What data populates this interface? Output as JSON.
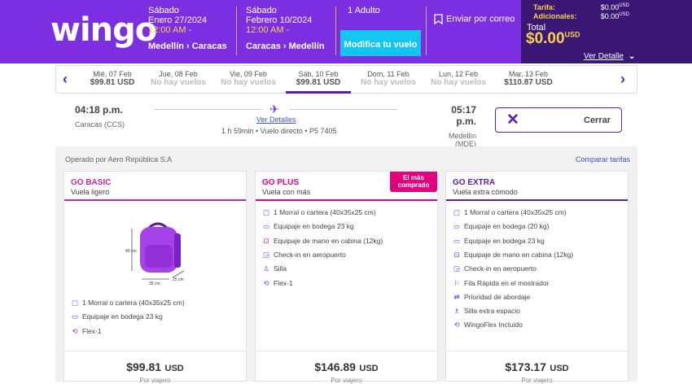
{
  "header": {
    "logo": "wingo",
    "outbound": {
      "day": "Sábado",
      "date": "Enero 27/2024",
      "time": "12:00 AM -",
      "route": "Medellín › Caracas"
    },
    "inbound": {
      "day": "Sábado",
      "date": "Febrero 10/2024",
      "time": "12:00 AM -",
      "route": "Caracas › Medellín"
    },
    "passengers": "1 Adulto",
    "modify_label": "Modifica tu vuelo",
    "email_label": "Enviar por correo"
  },
  "price_summary": {
    "tarifa_label": "Tarifa:",
    "tarifa_value": "$0.00",
    "adicionales_label": "Adicionales:",
    "adicionales_value": "$0.00",
    "currency_small": "USD",
    "total_label": "Total",
    "total_value": "$0.00",
    "total_currency": "USD",
    "details_label": "Ver Detalle"
  },
  "dates": [
    {
      "date": "Mié, 07 Feb",
      "price": "$99.81 USD",
      "available": true,
      "selected": false
    },
    {
      "date": "Jue, 08 Feb",
      "price": "No hay vuelos",
      "available": false,
      "selected": false
    },
    {
      "date": "Vie, 09 Feb",
      "price": "No hay vuelos",
      "available": false,
      "selected": false
    },
    {
      "date": "Sáb, 10 Feb",
      "price": "$99.81 USD",
      "available": true,
      "selected": true
    },
    {
      "date": "Dom, 11 Feb",
      "price": "No hay vuelos",
      "available": false,
      "selected": false
    },
    {
      "date": "Lun, 12 Feb",
      "price": "No hay vuelos",
      "available": false,
      "selected": false
    },
    {
      "date": "Mar, 13 Feb",
      "price": "$110.87 USD",
      "available": true,
      "selected": false
    }
  ],
  "flight": {
    "departure_time": "04:18 p.m.",
    "departure_city": "Caracas (CCS)",
    "arrival_time": "05:17 p.m.",
    "arrival_city": "Medellín (MDE)",
    "details_link": "Ver Detalles",
    "summary": "1 h 59min • Vuelo directo • P5 7405",
    "close_label": "Cerrar"
  },
  "fares": {
    "operated_by": "Operado por Aero República S.A",
    "compare_label": "Comparar tarifas",
    "bag_dims": {
      "height": "40 cm",
      "width": "35 cm",
      "depth": "25 cm"
    },
    "cards": [
      {
        "name": "GO BASIC",
        "subtitle": "Vuela ligero",
        "color": "#c02aa5",
        "features": [
          {
            "icon": "backpack-icon",
            "text": "1 Morral o cartera (40x35x25 cm)"
          },
          {
            "icon": "checked-bag-icon",
            "text": "Equipaje en bodega 23 kg"
          },
          {
            "icon": "flex-icon",
            "text": "Flex-1"
          }
        ],
        "price": "$99.81",
        "currency": "USD",
        "per": "Por viajero"
      },
      {
        "name": "GO PLUS",
        "subtitle": "Vuela con más",
        "color": "#e4007f",
        "badge": "El más comprado",
        "features": [
          {
            "icon": "backpack-icon",
            "text": "1 Morral o cartera (40x35x25 cm)"
          },
          {
            "icon": "checked-bag-icon",
            "text": "Equipaje en bodega 23 kg"
          },
          {
            "icon": "carry-on-icon",
            "text": "Equipaje de mano en cabina (12kg)"
          },
          {
            "icon": "checkin-icon",
            "text": "Check-in en aeropuerto"
          },
          {
            "icon": "seat-icon",
            "text": "Silla"
          },
          {
            "icon": "flex-icon",
            "text": "Flex-1"
          }
        ],
        "price": "$146.89",
        "currency": "USD",
        "per": "Por viajero"
      },
      {
        "name": "GO EXTRA",
        "subtitle": "Vuela extra cómodo",
        "color": "#5b1eb0",
        "features": [
          {
            "icon": "backpack-icon",
            "text": "1 Morral o cartera (40x35x25 cm)"
          },
          {
            "icon": "checked-bag-icon",
            "text": "Equipaje en bodega (20 kg)"
          },
          {
            "icon": "checked-bag-icon",
            "text": "Equipaje en bodega 23 kg"
          },
          {
            "icon": "carry-on-icon",
            "text": "Equipaje de mano en cabina (12kg)"
          },
          {
            "icon": "checkin-icon",
            "text": "Check-in en aeropuerto"
          },
          {
            "icon": "fast-lane-icon",
            "text": "Fila Rápida en el mostrador"
          },
          {
            "icon": "priority-icon",
            "text": "Prioridad de abordaje"
          },
          {
            "icon": "extra-seat-icon",
            "text": "Silla extra espacio"
          },
          {
            "icon": "flex-icon",
            "text": "WingoFlex Incluido"
          }
        ],
        "price": "$173.17",
        "currency": "USD",
        "per": "Por viajero"
      }
    ]
  }
}
